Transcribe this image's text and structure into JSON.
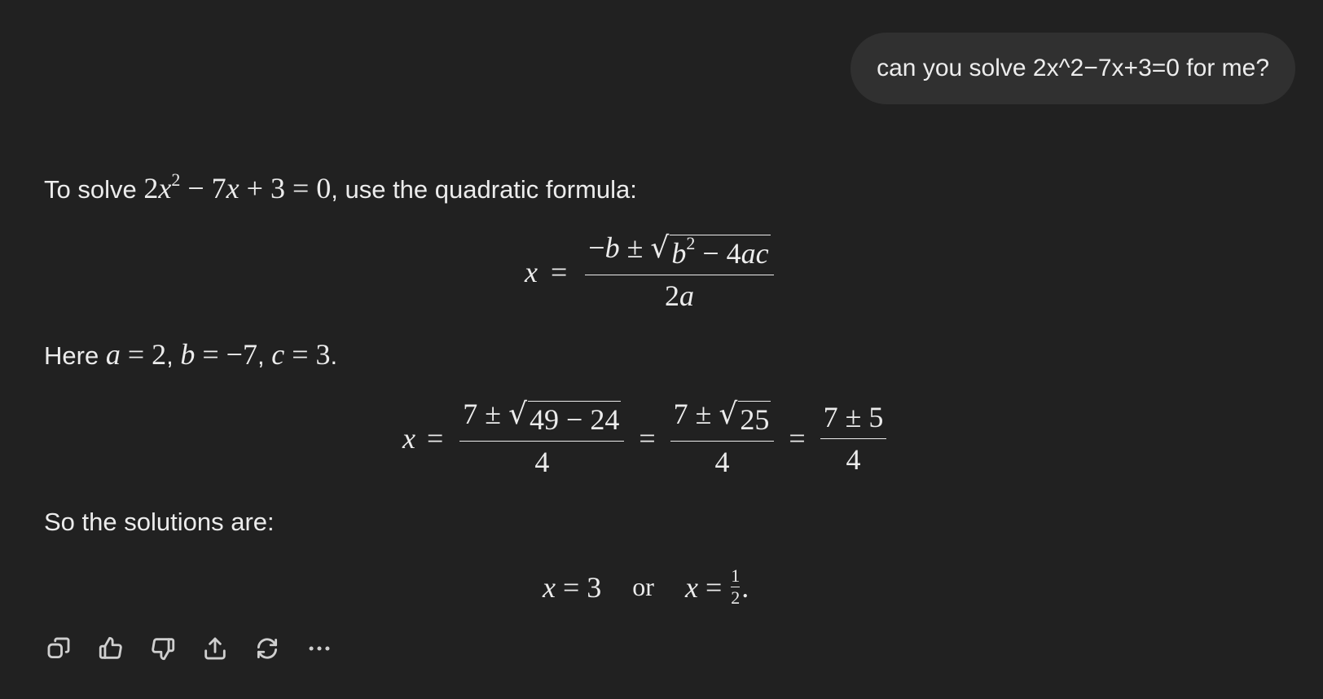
{
  "user_message": {
    "text": "can you solve 2x^2−7x+3=0 for me?"
  },
  "response": {
    "intro": {
      "prefix": "To solve ",
      "suffix": ", use the quadratic formula:"
    },
    "formula_lhs": "x",
    "here": {
      "prefix": "Here "
    },
    "solutions_text": "So the solutions are:",
    "solutions": {
      "or": "or"
    }
  },
  "toolbar": {
    "icons": [
      "copy-icon",
      "thumbs-up-icon",
      "thumbs-down-icon",
      "share-icon",
      "regenerate-icon",
      "more-icon"
    ]
  }
}
